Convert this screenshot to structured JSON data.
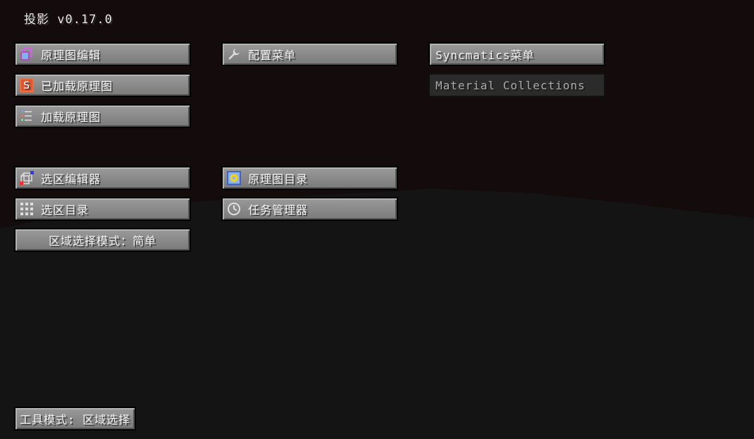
{
  "title": "投影 v0.17.0",
  "buttons": {
    "schematic_editing": "原理图编辑",
    "loaded_schematics": "已加载原理图",
    "load_schematics": "加载原理图",
    "area_editor": "选区编辑器",
    "area_browser": "选区目录",
    "area_selection_mode": "区域选择模式：简单",
    "config_menu": "配置菜单",
    "schematic_browser": "原理图目录",
    "task_manager": "任务管理器",
    "syncmatics_menu": "Syncmatics菜单",
    "material_collections": "Material Collections",
    "tool_mode": "工具模式: 区域选择"
  },
  "icons": {
    "schematic_editing": "purple-cube-icon",
    "loaded_schematics": "schematic-s-icon",
    "load_schematics": "list-icon",
    "area_editor": "selection-box-icon",
    "area_browser": "grid-icon",
    "config_menu": "wrench-icon",
    "schematic_browser": "schematic-folder-icon",
    "task_manager": "clock-icon"
  },
  "colors": {
    "sky": "#140b0d",
    "ground": "#141414",
    "button_face": "#8a8a8a",
    "button_disabled": "#2b2b2b",
    "text": "#f0f0f0"
  }
}
